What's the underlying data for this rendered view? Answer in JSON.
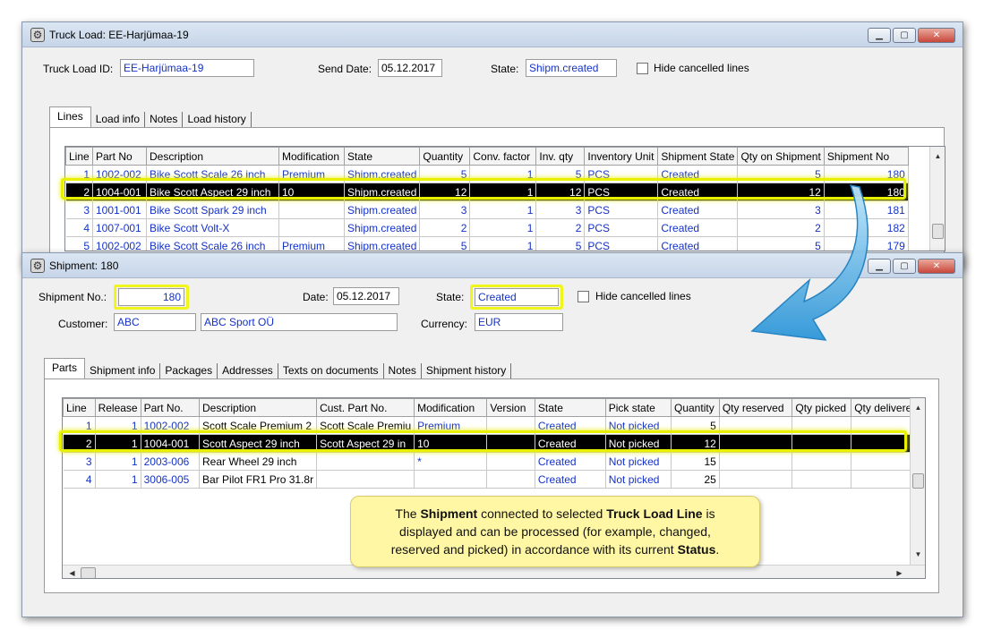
{
  "truck_window": {
    "title": "Truck Load: EE-Harjümaa-19",
    "id_label": "Truck Load ID:",
    "id_value": "EE-Harjümaa-19",
    "send_date_label": "Send Date:",
    "send_date_value": "05.12.2017",
    "state_label": "State:",
    "state_value": "Shipm.created",
    "hide_cancelled_label": "Hide cancelled lines",
    "tabs": [
      "Lines",
      "Load info",
      "Notes",
      "Load history"
    ],
    "grid": {
      "headers": [
        "Line",
        "Part No",
        "Description",
        "Modification",
        "State",
        "Quantity",
        "Conv. factor",
        "Inv. qty",
        "Inventory Unit",
        "Shipment State",
        "Qty on Shipment",
        "Shipment No"
      ],
      "rows": [
        [
          "1",
          "1002-002",
          "Bike Scott Scale 26 inch",
          "Premium",
          "Shipm.created",
          "5",
          "1",
          "5",
          "PCS",
          "Created",
          "5",
          "180"
        ],
        [
          "2",
          "1004-001",
          "Bike Scott Aspect 29 inch",
          "10",
          "Shipm.created",
          "12",
          "1",
          "12",
          "PCS",
          "Created",
          "12",
          "180"
        ],
        [
          "3",
          "1001-001",
          "Bike Scott Spark 29 inch",
          "",
          "Shipm.created",
          "3",
          "1",
          "3",
          "PCS",
          "Created",
          "3",
          "181"
        ],
        [
          "4",
          "1007-001",
          "Bike Scott Volt-X",
          "",
          "Shipm.created",
          "2",
          "1",
          "2",
          "PCS",
          "Created",
          "2",
          "182"
        ],
        [
          "5",
          "1002-002",
          "Bike Scott Scale 26 inch",
          "Premium",
          "Shipm.created",
          "5",
          "1",
          "5",
          "PCS",
          "Created",
          "5",
          "179"
        ]
      ]
    }
  },
  "shipment_window": {
    "title": "Shipment: 180",
    "no_label": "Shipment No.:",
    "no_value": "180",
    "date_label": "Date:",
    "date_value": "05.12.2017",
    "state_label": "State:",
    "state_value": "Created",
    "hide_cancelled_label": "Hide cancelled lines",
    "customer_label": "Customer:",
    "customer_code": "ABC",
    "customer_name": "ABC Sport OÜ",
    "currency_label": "Currency:",
    "currency_value": "EUR",
    "tabs": [
      "Parts",
      "Shipment info",
      "Packages",
      "Addresses",
      "Texts on documents",
      "Notes",
      "Shipment history"
    ],
    "grid": {
      "headers": [
        "Line",
        "Release",
        "Part No.",
        "Description",
        "Cust. Part No.",
        "Modification",
        "Version",
        "State",
        "Pick state",
        "Quantity",
        "Qty reserved",
        "Qty picked",
        "Qty delivered"
      ],
      "rows": [
        [
          "1",
          "1",
          "1002-002",
          "Scott Scale Premium 2",
          "Scott Scale Premiu",
          "Premium",
          "",
          "Created",
          "Not picked",
          "5",
          "",
          "",
          ""
        ],
        [
          "2",
          "1",
          "1004-001",
          "Scott Aspect 29 inch",
          "Scott Aspect 29 in",
          "10",
          "",
          "Created",
          "Not picked",
          "12",
          "",
          "",
          ""
        ],
        [
          "3",
          "1",
          "2003-006",
          "Rear Wheel 29 inch",
          "",
          "*",
          "",
          "Created",
          "Not picked",
          "15",
          "",
          "",
          ""
        ],
        [
          "4",
          "1",
          "3006-005",
          "Bar Pilot FR1 Pro 31.8r",
          "",
          "",
          "",
          "Created",
          "Not picked",
          "25",
          "",
          "",
          ""
        ]
      ]
    }
  },
  "callout": {
    "t1": "The ",
    "b1": "Shipment",
    "t2": " connected to selected ",
    "b2": "Truck Load Line",
    "t3": " is",
    "line2": "displayed and can be processed (for example, changed,",
    "t4": "reserved and picked) in accordance with its current ",
    "b3": "Status",
    "t5": "."
  },
  "colors": {
    "highlight": "#e8f000",
    "link_blue": "#1432c8",
    "arrow_blue": "#3aa4e0",
    "callout_bg": "#fff7a3"
  }
}
